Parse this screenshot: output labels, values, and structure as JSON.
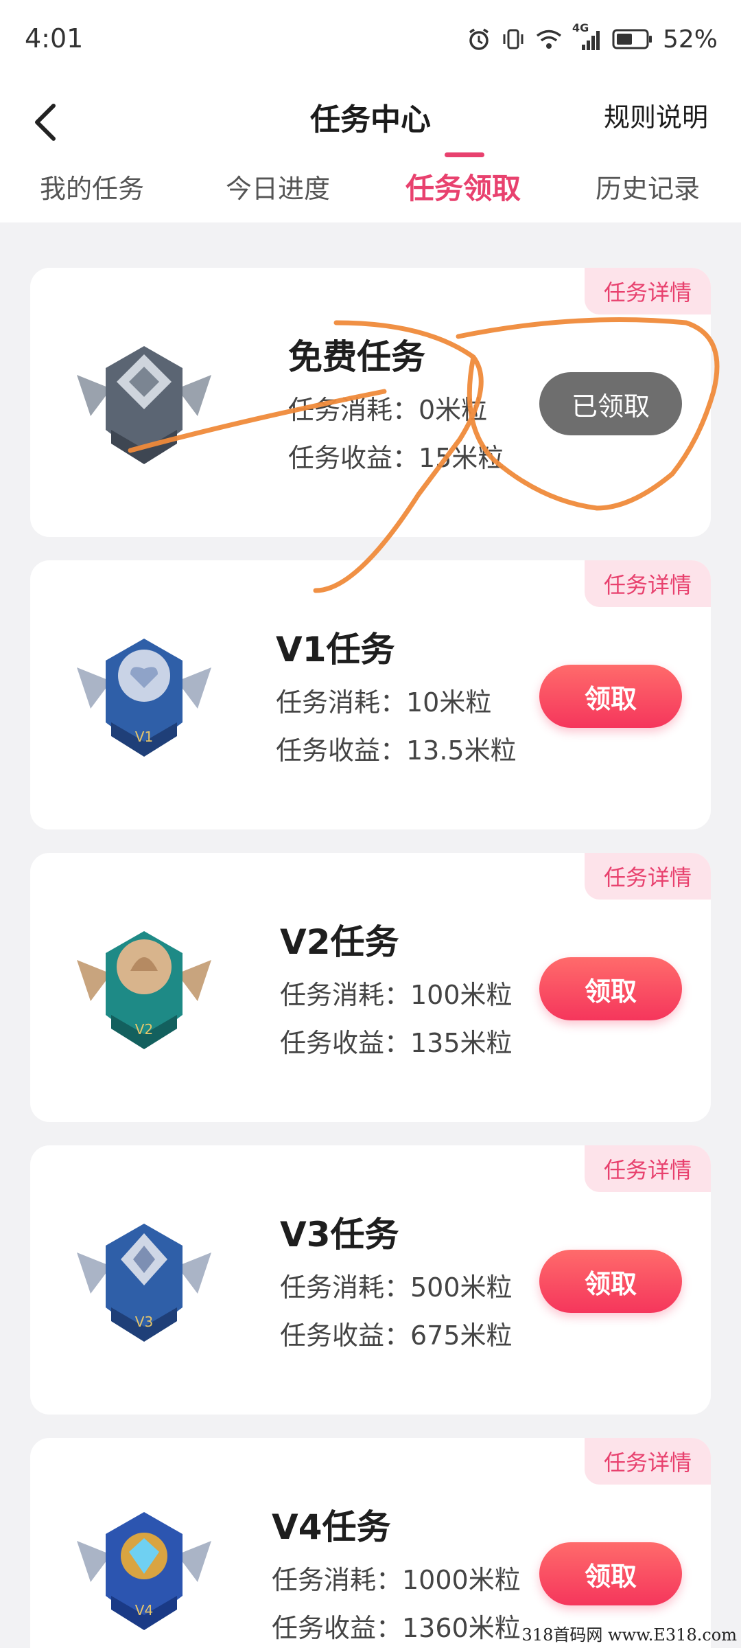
{
  "status_bar": {
    "time": "4:01",
    "network": "4G",
    "battery": "52%"
  },
  "header": {
    "title": "任务中心",
    "rules_label": "规则说明"
  },
  "tabs": [
    {
      "label": "我的任务",
      "active": false
    },
    {
      "label": "今日进度",
      "active": false
    },
    {
      "label": "任务领取",
      "active": true
    },
    {
      "label": "历史记录",
      "active": false
    }
  ],
  "tasks": [
    {
      "name": "免费任务",
      "cost": "任务消耗：0米粒",
      "reward": "任务收益：15米粒",
      "button": "已领取",
      "claimed": true,
      "detail": "任务详情",
      "badge_color": "#707a88",
      "badge_label": ""
    },
    {
      "name": "V1任务",
      "cost": "任务消耗：10米粒",
      "reward": "任务收益：13.5米粒",
      "button": "领取",
      "claimed": false,
      "detail": "任务详情",
      "badge_color": "#2f5fa8",
      "badge_label": "V1"
    },
    {
      "name": "V2任务",
      "cost": "任务消耗：100米粒",
      "reward": "任务收益：135米粒",
      "button": "领取",
      "claimed": false,
      "detail": "任务详情",
      "badge_color": "#1e8a86",
      "badge_label": "V2"
    },
    {
      "name": "V3任务",
      "cost": "任务消耗：500米粒",
      "reward": "任务收益：675米粒",
      "button": "领取",
      "claimed": false,
      "detail": "任务详情",
      "badge_color": "#2f5fa8",
      "badge_label": "V3"
    },
    {
      "name": "V4任务",
      "cost": "任务消耗：1000米粒",
      "reward": "任务收益：1360米粒",
      "button": "领取",
      "claimed": false,
      "detail": "任务详情",
      "badge_color": "#2c55b0",
      "badge_label": "V4"
    }
  ],
  "watermark": "318首码网 www.E318.com",
  "colors": {
    "accent": "#e8416e",
    "button": "#f5365c",
    "claimed": "#6e6e6e",
    "scribble": "#ef8a3a"
  }
}
